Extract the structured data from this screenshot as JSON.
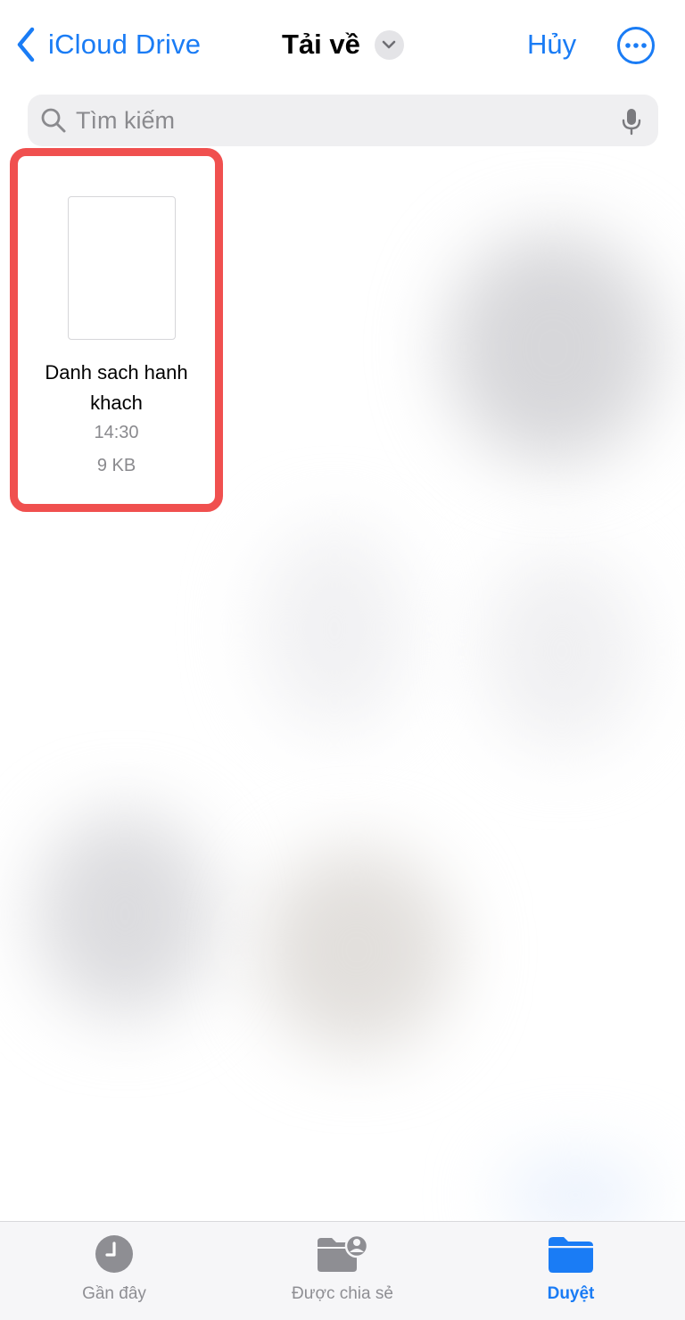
{
  "nav": {
    "back_label": "iCloud Drive",
    "title": "Tải về",
    "cancel_label": "Hủy"
  },
  "search": {
    "placeholder": "Tìm kiếm"
  },
  "file": {
    "name": "Danh sach hanh khach",
    "time": "14:30",
    "size": "9 KB"
  },
  "tabs": [
    {
      "label": "Gần đây",
      "icon": "clock-icon",
      "active": false
    },
    {
      "label": "Được chia sẻ",
      "icon": "shared-folder-icon",
      "active": false
    },
    {
      "label": "Duyệt",
      "icon": "folder-icon",
      "active": true
    }
  ],
  "colors": {
    "accent": "#1a7cf5",
    "highlight_border": "#f0504f",
    "secondary_text": "#8a8a8e",
    "inactive_icon": "#8e8e93"
  }
}
